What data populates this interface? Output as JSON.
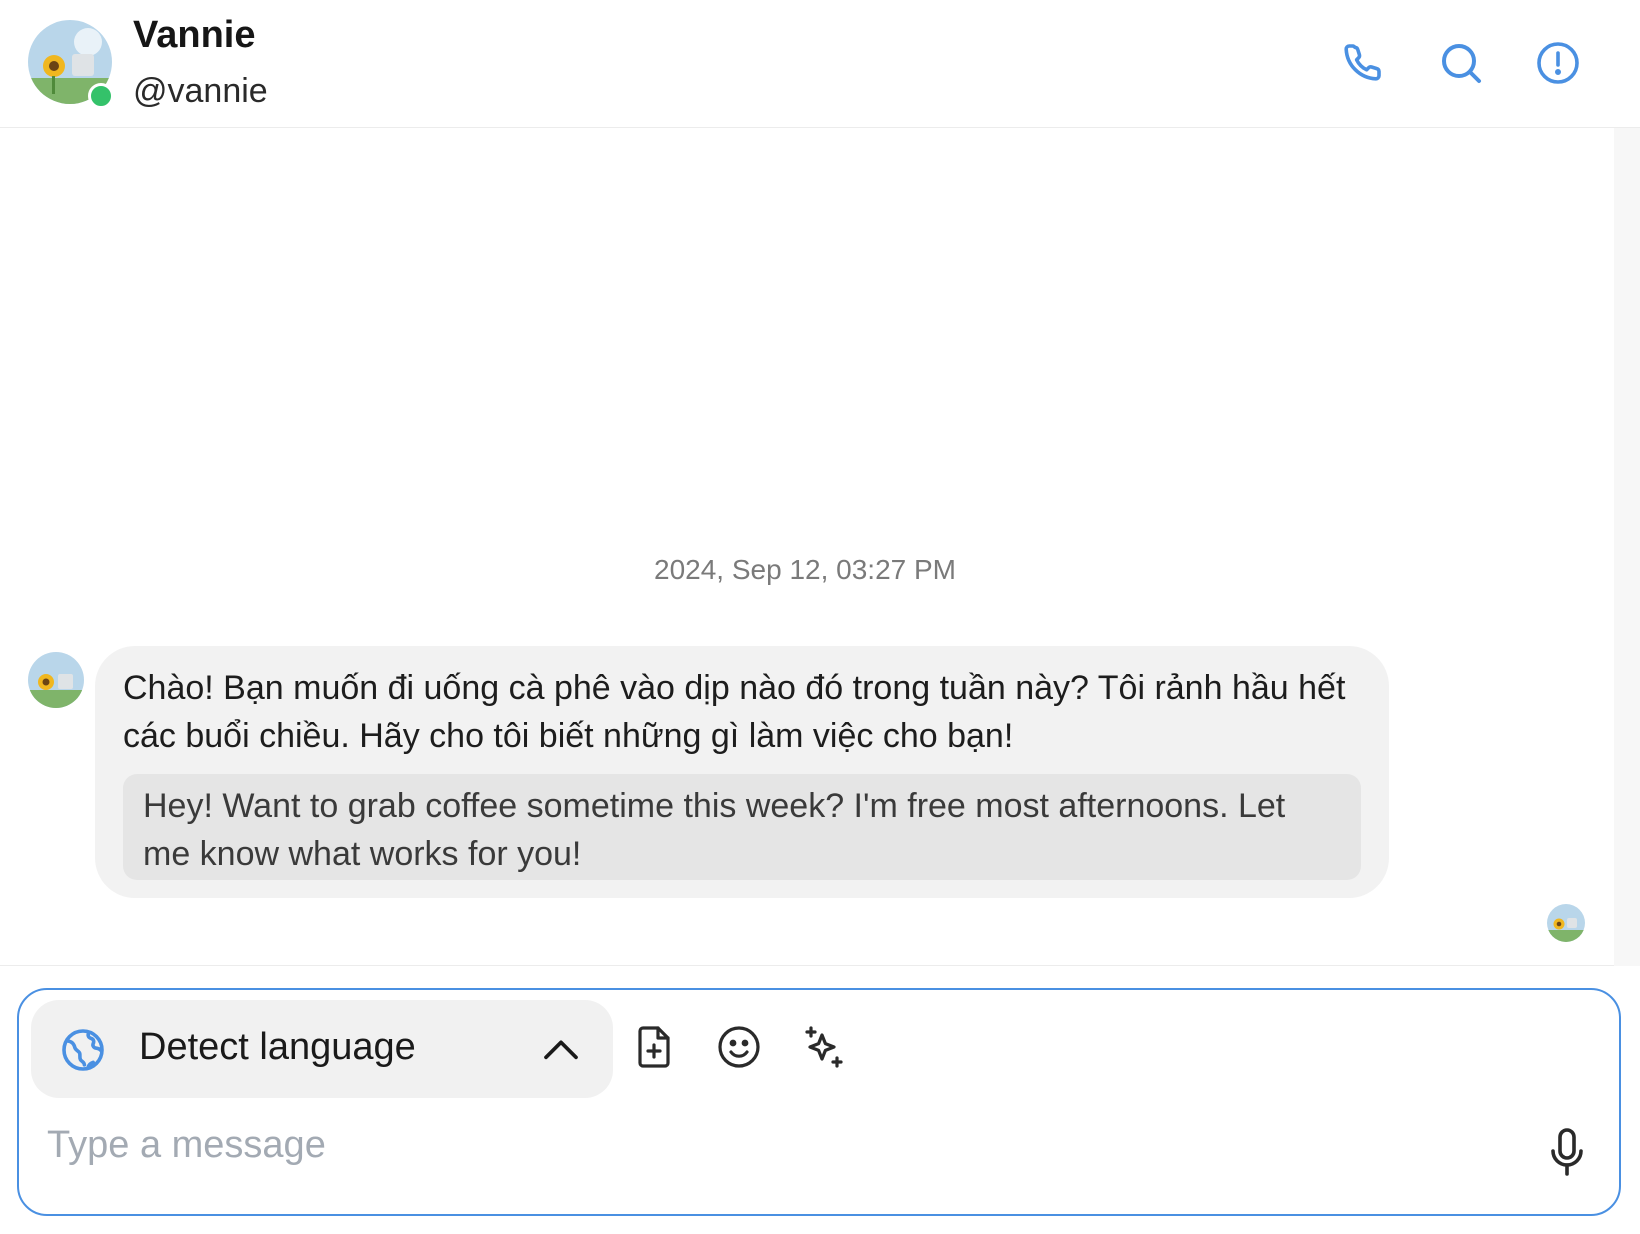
{
  "header": {
    "name": "Vannie",
    "handle": "@vannie",
    "online": true
  },
  "conversation": {
    "timestamp": "2024, Sep 12, 03:27 PM",
    "messages": [
      {
        "text": "Chào! Bạn muốn đi uống cà phê vào dịp nào đó trong tuần này? Tôi rảnh hầu hết các buổi chiều. Hãy cho tôi biết những gì làm việc cho bạn!",
        "translation": "Hey! Want to grab coffee sometime this week? I'm free most afternoons. Let me know what works for you!"
      }
    ]
  },
  "composer": {
    "language_label": "Detect language",
    "placeholder": "Type a message"
  },
  "icons": {
    "call": "phone-icon",
    "search": "search-icon",
    "info": "info-icon",
    "language": "globe-icon",
    "attach": "file-plus-icon",
    "emoji": "smiley-icon",
    "ai": "sparkles-icon",
    "voice": "microphone-icon"
  },
  "colors": {
    "accent": "#4a90e2",
    "online": "#34c26a",
    "bubble": "#f2f2f2",
    "translation_bg": "#e5e5e5"
  }
}
